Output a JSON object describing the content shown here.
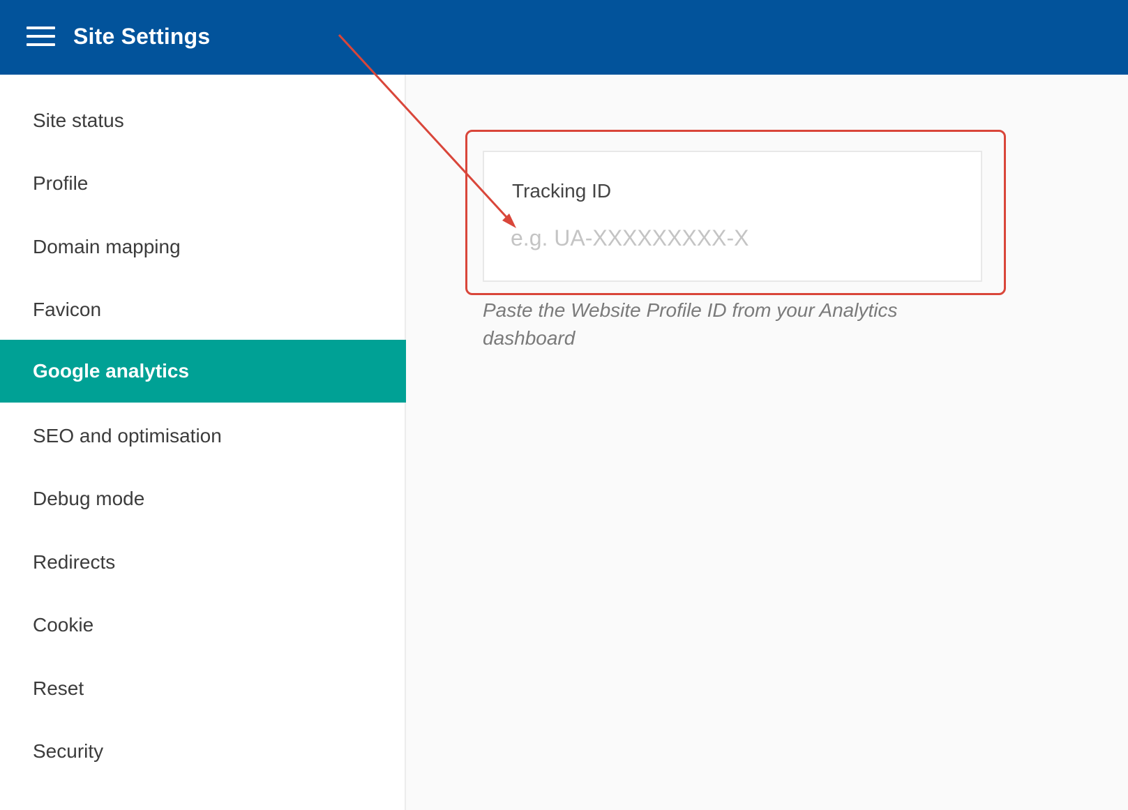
{
  "header": {
    "title": "Site Settings",
    "menu_icon": "hamburger-icon"
  },
  "sidebar": {
    "items": [
      {
        "label": "Site status"
      },
      {
        "label": "Profile"
      },
      {
        "label": "Domain mapping"
      },
      {
        "label": "Favicon"
      },
      {
        "label": "Google analytics",
        "active": true
      },
      {
        "label": "SEO and optimisation"
      },
      {
        "label": "Debug mode"
      },
      {
        "label": "Redirects"
      },
      {
        "label": "Cookie"
      },
      {
        "label": "Reset"
      },
      {
        "label": "Security"
      }
    ]
  },
  "main": {
    "tracking": {
      "label": "Tracking ID",
      "value": "",
      "placeholder": "e.g. UA-XXXXXXXXX-X"
    },
    "help_text": "Paste the Website Profile ID from your Analytics dashboard"
  },
  "colors": {
    "header_bg": "#02539b",
    "active_item_bg": "#00a195",
    "annotation": "#d9463a"
  }
}
